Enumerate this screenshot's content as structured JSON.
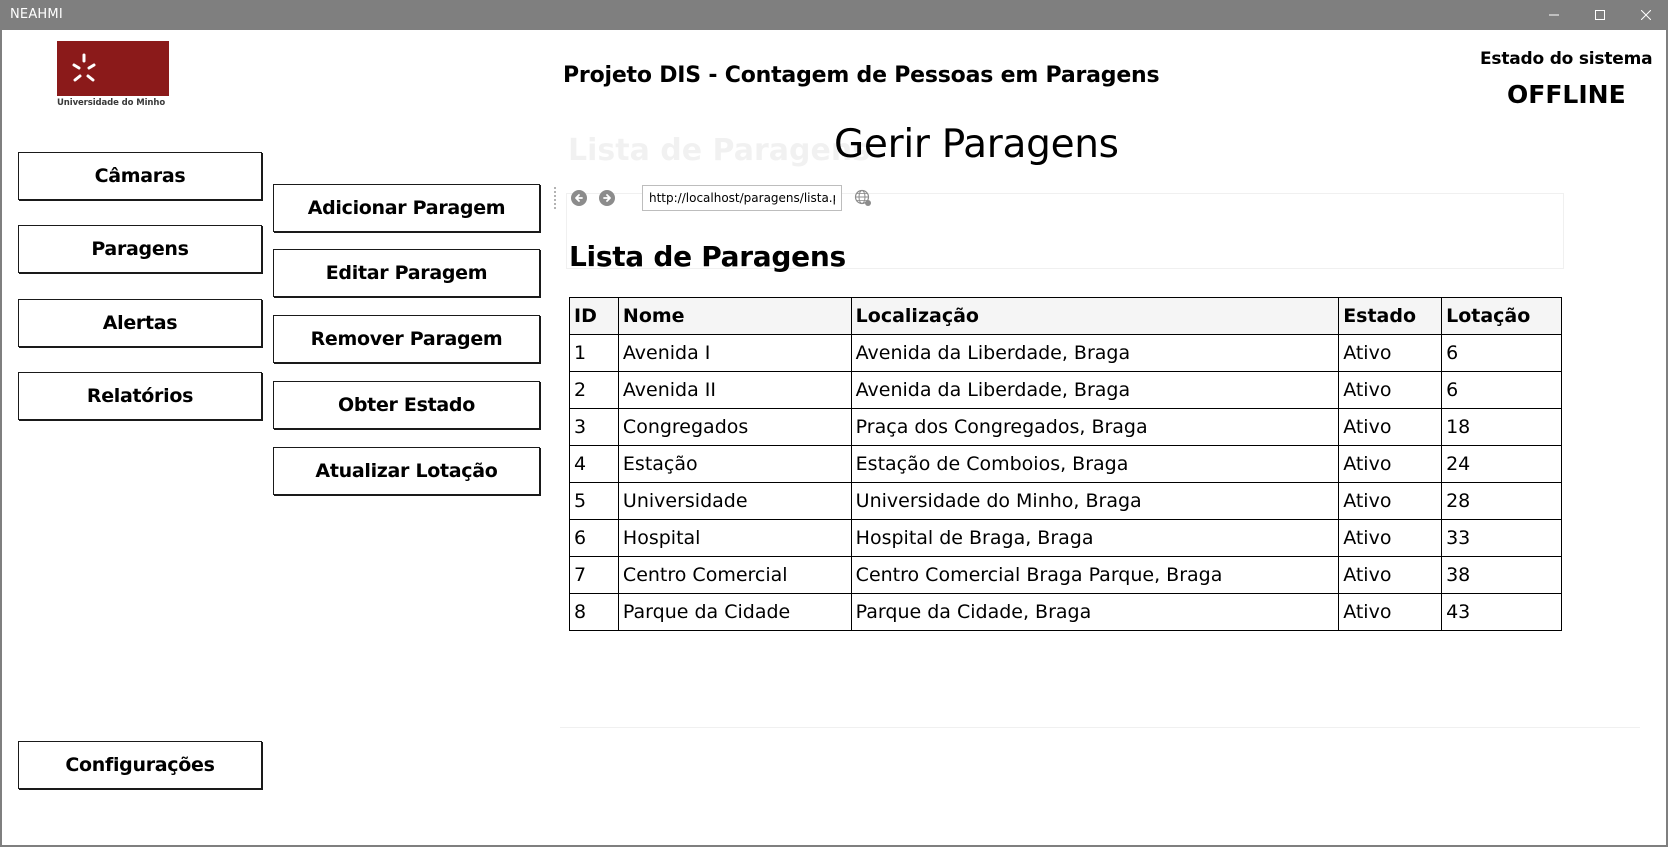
{
  "window": {
    "title": "NEAHMI",
    "controls": {
      "minimize_icon": "minimize-icon",
      "maximize_icon": "maximize-icon",
      "close_icon": "close-icon"
    }
  },
  "header": {
    "logo_caption": "Universidade do Minho",
    "logo_color": "#8b1a1a",
    "title": "Projeto DIS - Contagem de Pessoas em Paragens",
    "system_status_label": "Estado do sistema",
    "system_status_value": "OFFLINE"
  },
  "sidebar": {
    "items": [
      {
        "label": "Câmaras"
      },
      {
        "label": "Paragens"
      },
      {
        "label": "Alertas"
      },
      {
        "label": "Relatórios"
      }
    ],
    "settings_label": "Configurações"
  },
  "actions": {
    "items": [
      {
        "label": "Adicionar Paragem"
      },
      {
        "label": "Editar Paragem"
      },
      {
        "label": "Remover Paragem"
      },
      {
        "label": "Obter Estado"
      },
      {
        "label": "Atualizar Lotação"
      }
    ]
  },
  "main": {
    "heading": "Gerir Paragens",
    "ghost_heading": "Lista de Paragens",
    "browser": {
      "url": "http://localhost/paragens/lista.php",
      "back_icon": "back-arrow-icon",
      "forward_icon": "forward-arrow-icon",
      "globe_icon": "globe-icon"
    },
    "list_heading": "Lista de Paragens",
    "table": {
      "columns": [
        "ID",
        "Nome",
        "Localização",
        "Estado",
        "Lotação"
      ],
      "rows": [
        [
          "1",
          "Avenida I",
          "Avenida da Liberdade, Braga",
          "Ativo",
          "6"
        ],
        [
          "2",
          "Avenida II",
          "Avenida da Liberdade, Braga",
          "Ativo",
          "6"
        ],
        [
          "3",
          "Congregados",
          "Praça dos Congregados, Braga",
          "Ativo",
          "18"
        ],
        [
          "4",
          "Estação",
          "Estação de Comboios, Braga",
          "Ativo",
          "24"
        ],
        [
          "5",
          "Universidade",
          "Universidade do Minho, Braga",
          "Ativo",
          "28"
        ],
        [
          "6",
          "Hospital",
          "Hospital de Braga, Braga",
          "Ativo",
          "33"
        ],
        [
          "7",
          "Centro Comercial",
          "Centro Comercial Braga Parque, Braga",
          "Ativo",
          "38"
        ],
        [
          "8",
          "Parque da Cidade",
          "Parque da Cidade, Braga",
          "Ativo",
          "43"
        ]
      ]
    }
  }
}
